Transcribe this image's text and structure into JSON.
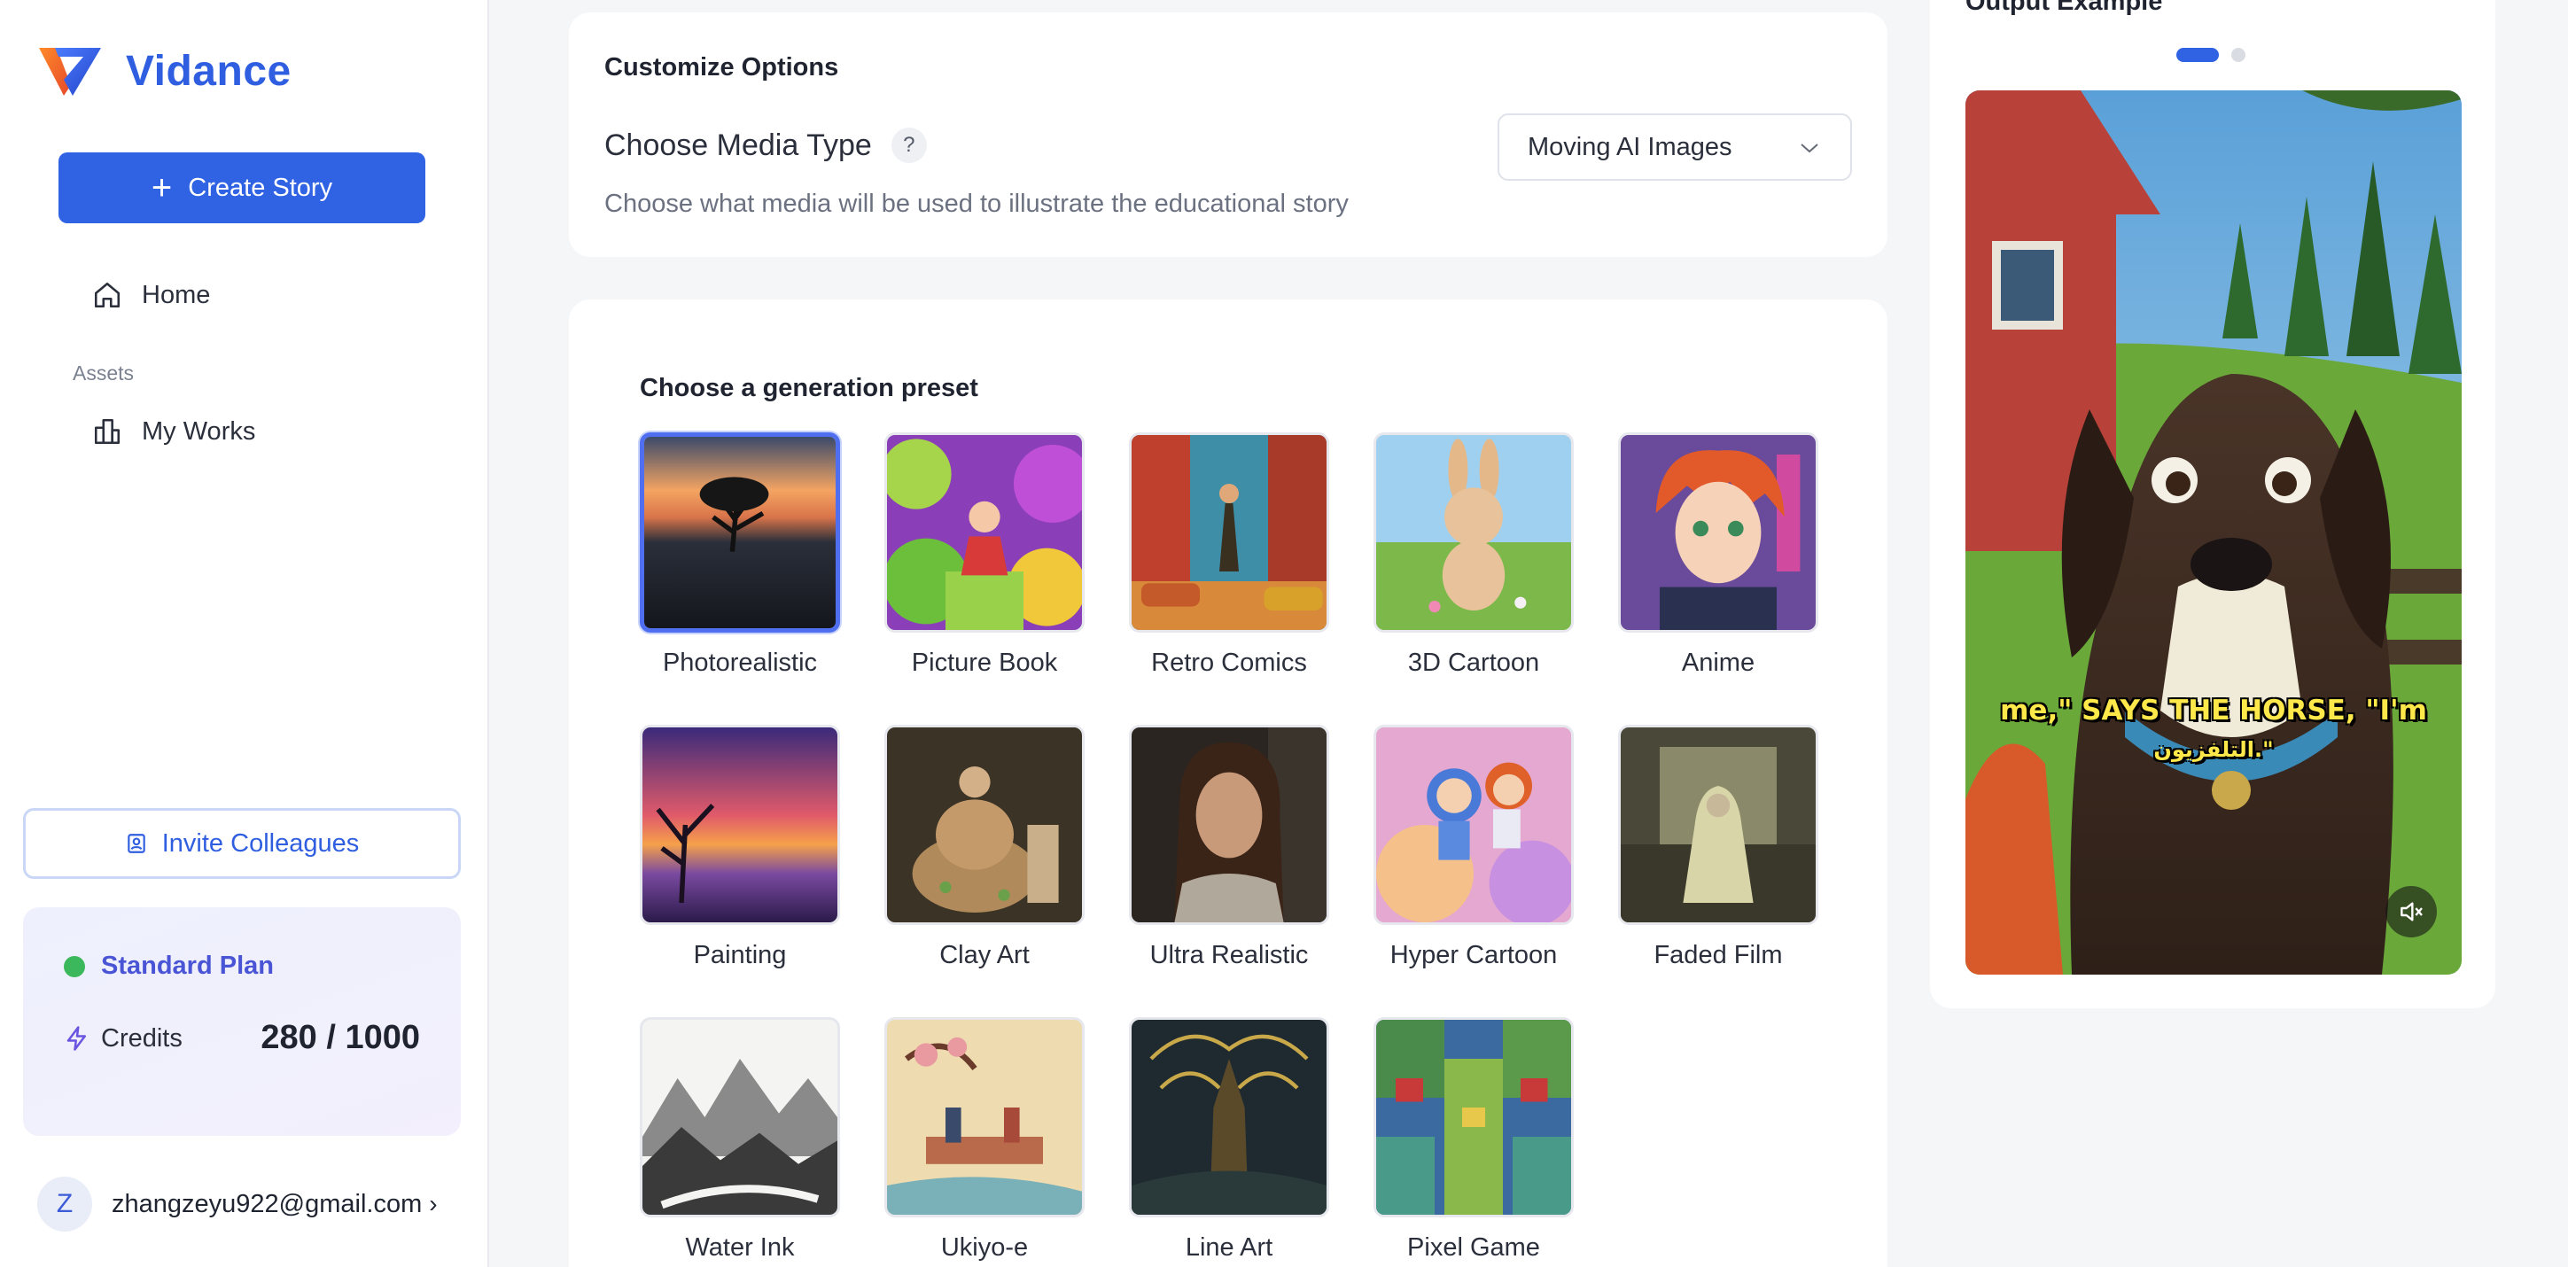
{
  "brand": {
    "name": "Vidance"
  },
  "sidebar": {
    "create_label": "Create Story",
    "home_label": "Home",
    "section_assets": "Assets",
    "works_label": "My Works",
    "invite_label": "Invite Colleagues",
    "plan": {
      "name": "Standard Plan",
      "credits_label": "Credits",
      "credits_value": "280 / 1000",
      "status_color": "#3cb85c"
    },
    "user": {
      "initial": "Z",
      "email": "zhangzeyu922@gmail.com",
      "chevron": "›"
    }
  },
  "options": {
    "title": "Customize Options",
    "media_type_label": "Choose Media Type",
    "help_glyph": "?",
    "media_type_desc": "Choose what media will be used to illustrate the educational story",
    "media_type_value": "Moving AI Images"
  },
  "presets": {
    "title": "Choose a generation preset",
    "items": [
      {
        "label": "Photorealistic",
        "selected": true
      },
      {
        "label": "Picture Book"
      },
      {
        "label": "Retro Comics"
      },
      {
        "label": "3D Cartoon"
      },
      {
        "label": "Anime"
      },
      {
        "label": "Painting"
      },
      {
        "label": "Clay Art"
      },
      {
        "label": "Ultra Realistic"
      },
      {
        "label": "Hyper Cartoon"
      },
      {
        "label": "Faded Film"
      },
      {
        "label": "Water Ink"
      },
      {
        "label": "Ukiyo-e"
      },
      {
        "label": "Line Art"
      },
      {
        "label": "Pixel Game"
      }
    ]
  },
  "output": {
    "title": "Output Example",
    "subtitle_line1": "me,\" SAYS THE HORSE, \"I'm",
    "subtitle_line2": "التلفزيون.\"",
    "carousel": {
      "count": 2,
      "active": 0
    }
  },
  "colors": {
    "accent": "#2f63e4",
    "brand": "#2f5fe0",
    "plan_text": "#4a55d6"
  }
}
